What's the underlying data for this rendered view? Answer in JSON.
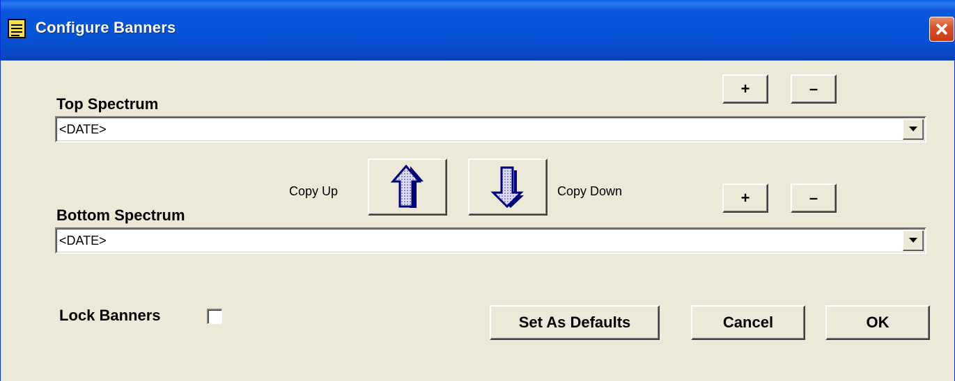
{
  "window": {
    "title": "Configure Banners",
    "icon": "notepad-icon",
    "close_icon": "close-icon",
    "colors": {
      "titlebar": "#0653d6",
      "close": "#d9542a",
      "face": "#ece9d8",
      "arrow": "#000080"
    }
  },
  "top": {
    "label": "Top Spectrum",
    "value": "<DATE>",
    "plus_label": "+",
    "minus_label": "–"
  },
  "bottom": {
    "label": "Bottom Spectrum",
    "value": "<DATE>",
    "plus_label": "+",
    "minus_label": "–"
  },
  "copy": {
    "up_label": "Copy Up",
    "down_label": "Copy Down",
    "up_icon": "arrow-up-icon",
    "down_icon": "arrow-down-icon"
  },
  "lock": {
    "label": "Lock Banners",
    "checked": false
  },
  "actions": {
    "set_defaults_label": "Set As Defaults",
    "cancel_label": "Cancel",
    "ok_label": "OK"
  }
}
